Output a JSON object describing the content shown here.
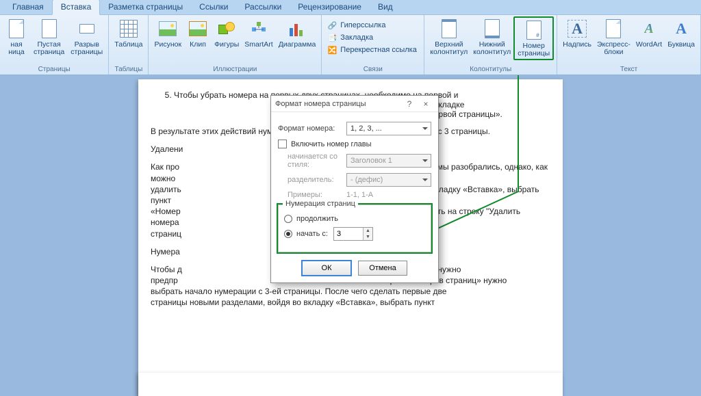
{
  "colors": {
    "highlight_green": "#118a2c",
    "ribbon_blue": "#1b4a7a"
  },
  "tabs": {
    "items": [
      "Главная",
      "Вставка",
      "Разметка страницы",
      "Ссылки",
      "Рассылки",
      "Рецензирование",
      "Вид"
    ],
    "active_index": 1
  },
  "ribbon": {
    "groups": {
      "pages": {
        "label": "Страницы",
        "items": [
          "ная\nница",
          "Пустая\nстраница",
          "Разрыв\nстраницы"
        ]
      },
      "tables": {
        "label": "Таблицы",
        "items": [
          "Таблица"
        ]
      },
      "illus": {
        "label": "Иллюстрации",
        "items": [
          "Рисунок",
          "Клип",
          "Фигуры",
          "SmartArt",
          "Диаграмма"
        ]
      },
      "links": {
        "label": "Связи",
        "items": [
          "Гиперссылка",
          "Закладка",
          "Перекрестная ссылка"
        ]
      },
      "hf": {
        "label": "Колонтитулы",
        "items": [
          "Верхний\nколонтитул",
          "Нижний\nколонтитул",
          "Номер\nстраницы"
        ]
      },
      "text": {
        "label": "Текст",
        "items": [
          "Надпись",
          "Экспресс-блоки",
          "WordArt",
          "Буквица"
        ]
      }
    }
  },
  "document": {
    "list_start": 5,
    "list_item": "Чтобы убрать номера на первых двух страницах, необходимо на первой и",
    "frag_right1": "номерах и в появившейся вкладке",
    "frag_right2": "й колонтитул для первой страницы».",
    "p_result": "В результате этих действий нумер                               ия теперь начинается с 3 страницы.",
    "p_delete": "Удалени",
    "p_howto_a": "Как про",
    "p_howto_b": "ей мы разобрались, однако, как можно",
    "p_howto_c": "удалить",
    "p_howto_d": "во вкладку «Вставка», выбрать пункт",
    "p_howto_e": "«Номер",
    "p_howto_f": "ажать на строку \"Удалить номера",
    "p_howto_g": "страниц",
    "p_num": "Нумера",
    "p_bottom": "Чтобы д                                                                            ицы в «Ворде 2007», нужно\nпредпр                                                                              нкте «Формат номеров страниц» нужно\nвыбрать начало нумерации с 3-ей страницы. После чего сделать первые две\nстраницы новыми разделами, войдя во вкладку «Вставка», выбрать пункт"
  },
  "dialog": {
    "title": "Формат номера страницы",
    "format_label": "Формат номера:",
    "format_value": "1, 2, 3, ...",
    "include_chapter": "Включить номер главы",
    "starts_style_label": "начинается со стиля:",
    "starts_style_value": "Заголовок 1",
    "separator_label": "разделитель:",
    "separator_value": "-   (дефис)",
    "examples_label": "Примеры:",
    "examples_value": "1-1, 1-A",
    "fieldset_legend": "Нумерация страниц",
    "radio_continue": "продолжить",
    "radio_startat": "начать с:",
    "startat_value": "3",
    "ok": "ОК",
    "cancel": "Отмена"
  }
}
